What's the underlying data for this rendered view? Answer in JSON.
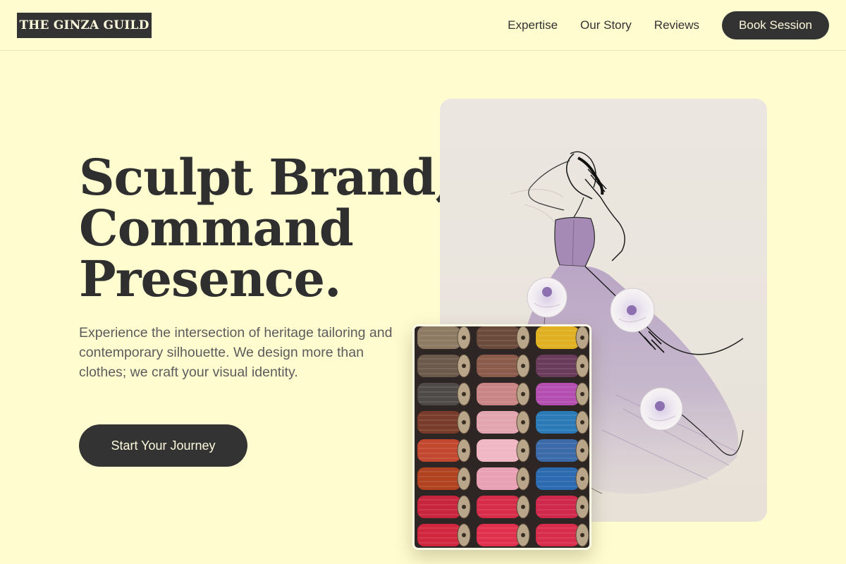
{
  "brand": {
    "name": "THE GINZA GUILD"
  },
  "nav": {
    "links": [
      "Expertise",
      "Our Story",
      "Reviews"
    ],
    "cta": "Book Session"
  },
  "hero": {
    "headline_lines": [
      "Sculpt Brand,",
      "Command",
      "Presence."
    ],
    "subcopy": "Experience the intersection of heritage tailoring and contemporary silhouette. We design more than clothes; we craft your visual identity.",
    "cta": "Start Your Journey"
  },
  "images": {
    "sketch": "fashion-sketch-gown-illustration",
    "threads": "thread-spools-photo"
  },
  "colors": {
    "background": "#fffcd0",
    "dark": "#333333",
    "light_text": "#fdf9dc",
    "body_text": "#5c5c5c"
  }
}
